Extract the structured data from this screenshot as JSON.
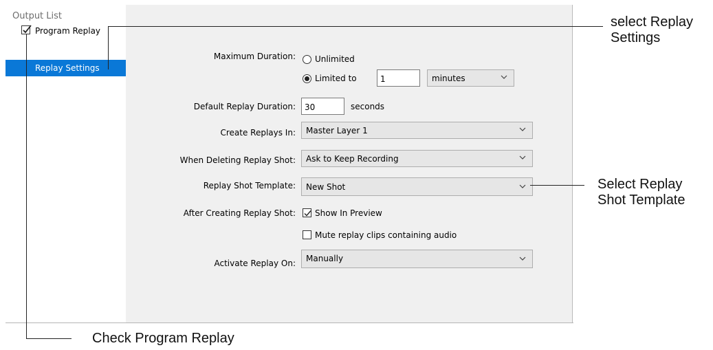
{
  "sidebar": {
    "title": "Output List",
    "program_replay": {
      "label": "Program Replay",
      "checked": true
    },
    "selected_item": "Replay Settings"
  },
  "settings": {
    "max_duration": {
      "label": "Maximum Duration:",
      "unlimited_label": "Unlimited",
      "limited_label": "Limited to",
      "limited_value": "1",
      "unit": "minutes",
      "selected": "limited"
    },
    "default_duration": {
      "label": "Default Replay Duration:",
      "value": "30",
      "unit": "seconds"
    },
    "create_in": {
      "label": "Create Replays In:",
      "value": "Master Layer 1"
    },
    "when_deleting": {
      "label": "When Deleting Replay Shot:",
      "value": "Ask to Keep Recording"
    },
    "shot_template": {
      "label": "Replay Shot Template:",
      "value": "New Shot"
    },
    "after_creating": {
      "label": "After Creating Replay Shot:",
      "show_preview_label": "Show In Preview",
      "show_preview_checked": true,
      "mute_label": "Mute replay clips containing audio",
      "mute_checked": false
    },
    "activate_on": {
      "label": "Activate Replay On:",
      "value": "Manually"
    }
  },
  "annotations": {
    "select_replay_settings": "select Replay\nSettings",
    "select_template": "Select Replay\nShot Template",
    "check_program_replay": "Check Program Replay"
  },
  "colors": {
    "selection": "#0a78d7",
    "panel_bg": "#f0f0f0",
    "dropdown_bg": "#e6e6e6"
  },
  "icons": {
    "checkmark": "check-icon",
    "dropdown": "chevron-down-icon"
  }
}
